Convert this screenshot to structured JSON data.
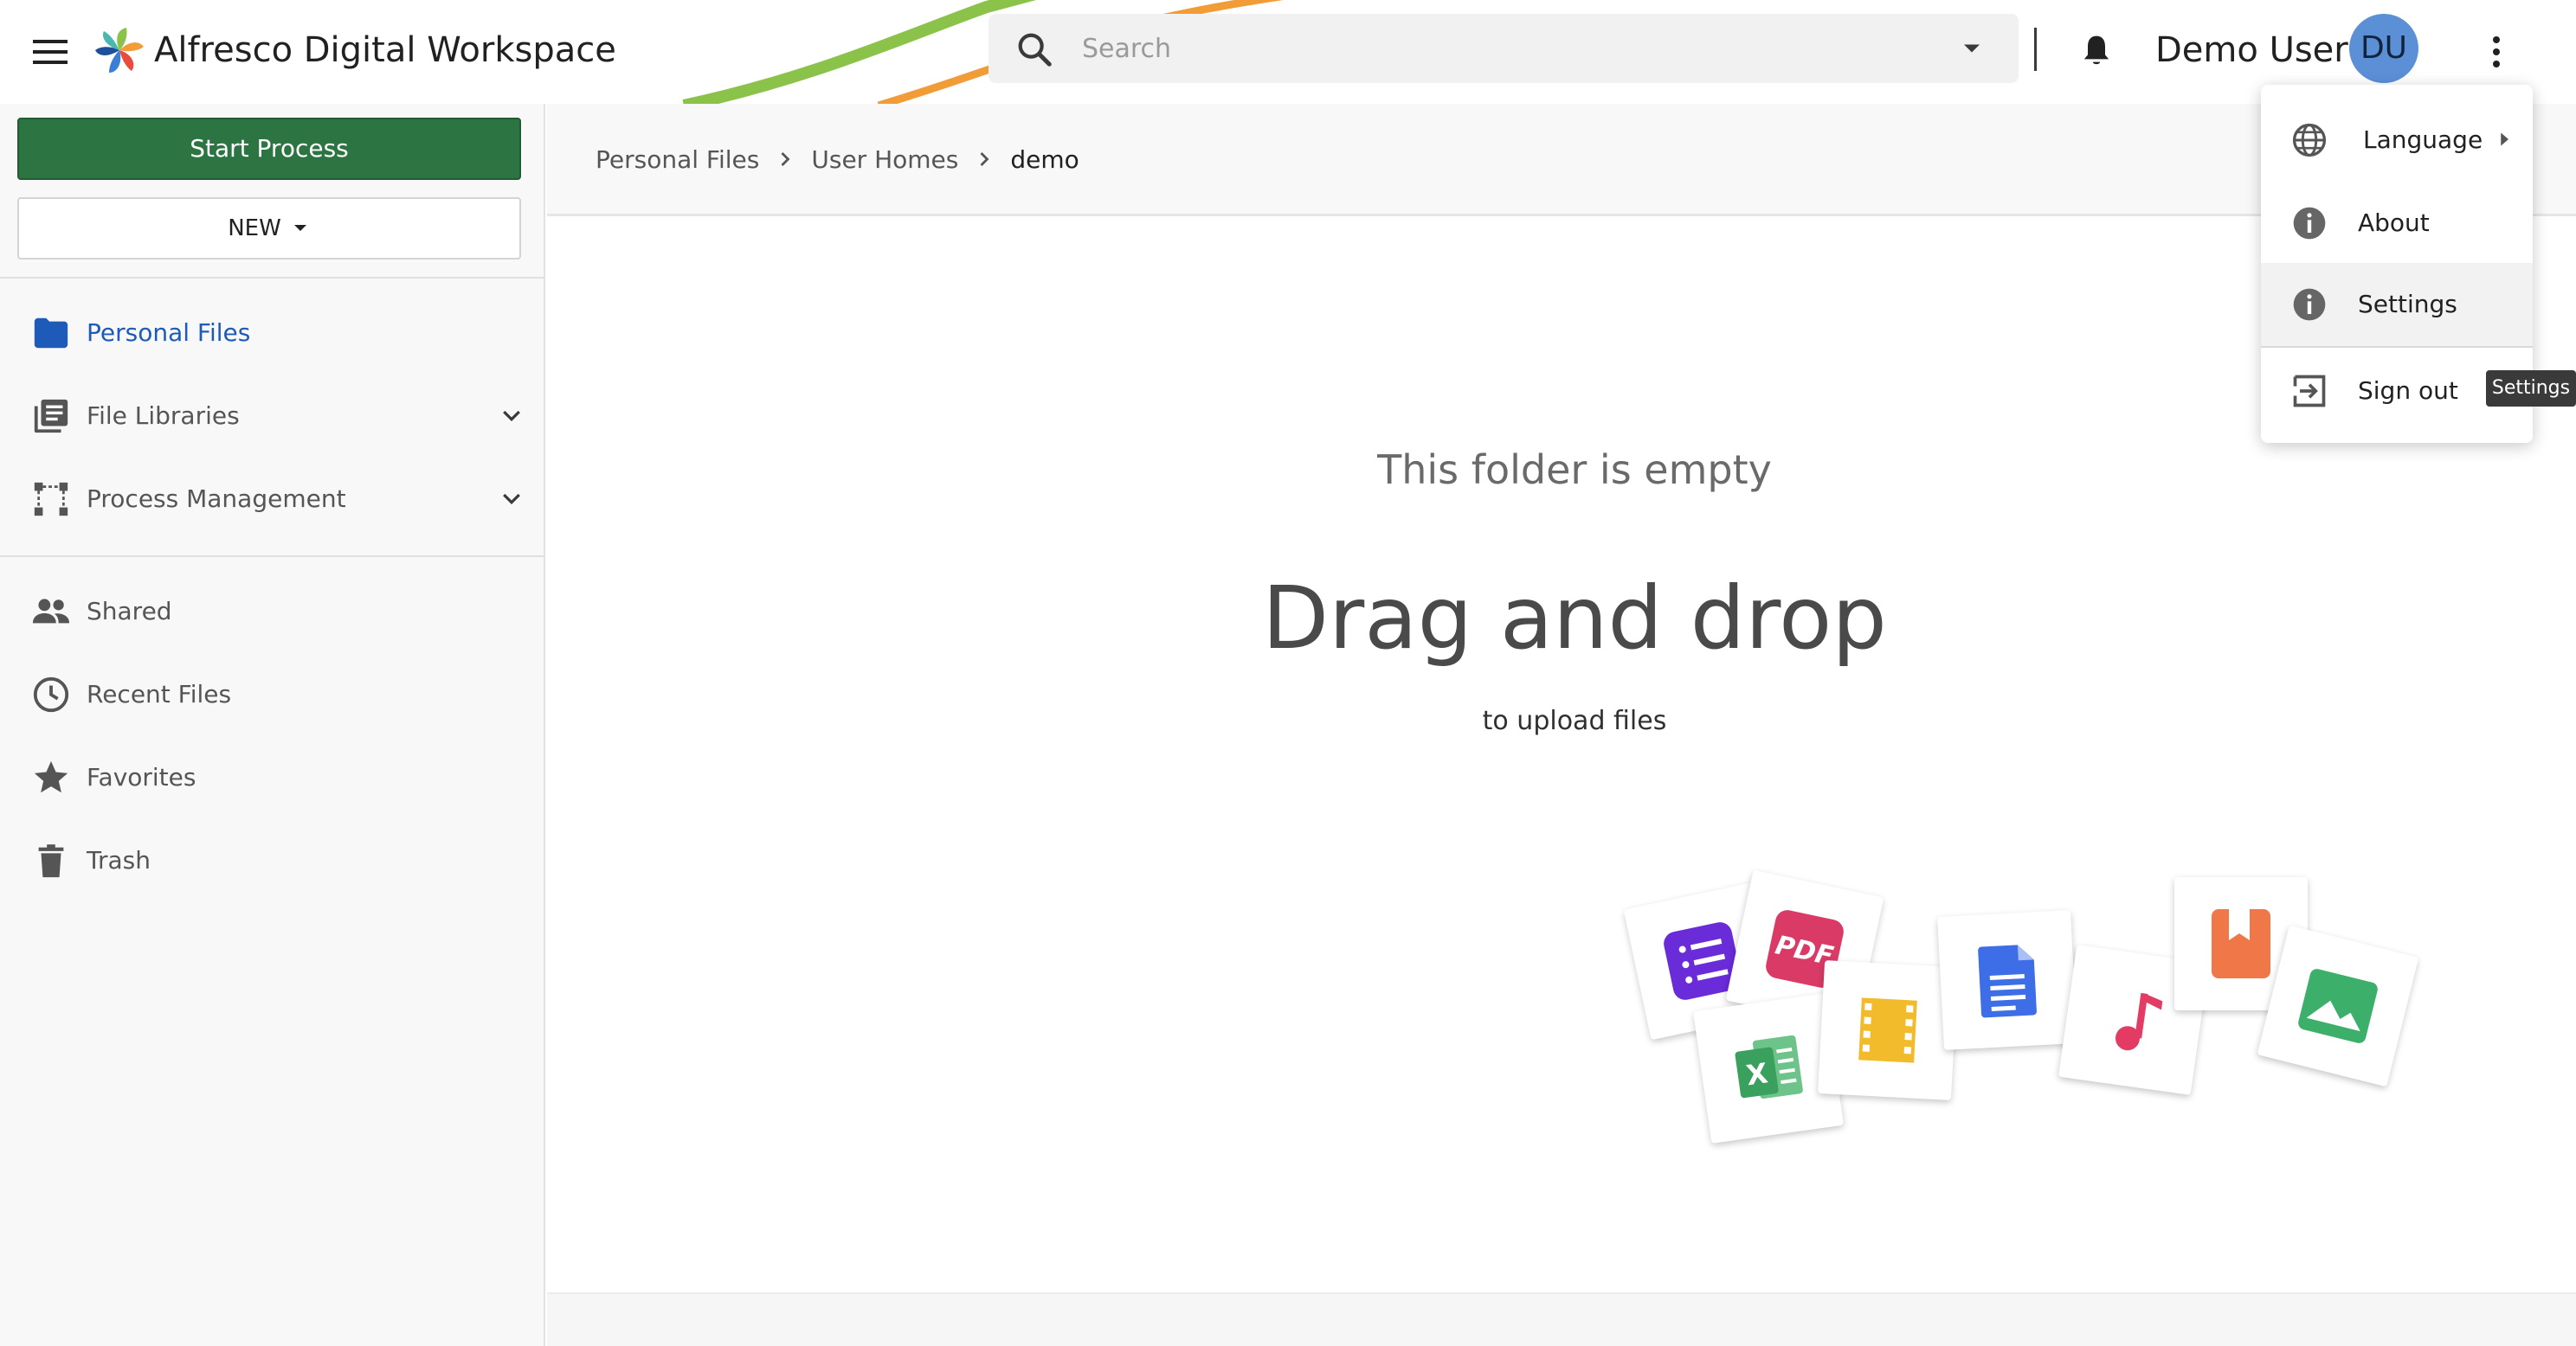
{
  "header": {
    "app_title": "Alfresco Digital Workspace",
    "search_placeholder": "Search",
    "user_name": "Demo User",
    "user_initials": "DU",
    "icons": [
      "menu-icon",
      "alfresco-logo",
      "search-icon",
      "dropdown-arrow-icon",
      "bell-icon",
      "more-vert-icon"
    ]
  },
  "sidebar": {
    "start_process": "Start Process",
    "new_button": "NEW",
    "nav": [
      {
        "label": "Personal Files",
        "icon": "folder-icon",
        "active": true
      },
      {
        "label": "File Libraries",
        "icon": "library-icon",
        "expandable": true
      },
      {
        "label": "Process Management",
        "icon": "process-icon",
        "expandable": true
      },
      {
        "label": "Shared",
        "icon": "people-icon"
      },
      {
        "label": "Recent Files",
        "icon": "clock-icon"
      },
      {
        "label": "Favorites",
        "icon": "star-icon"
      },
      {
        "label": "Trash",
        "icon": "trash-icon"
      }
    ]
  },
  "breadcrumb": [
    "Personal Files",
    "User Homes",
    "demo"
  ],
  "empty_state": {
    "title": "This folder is empty",
    "headline": "Drag and drop",
    "subtitle": "to upload files",
    "file_icons": [
      "form-icon",
      "pdf-icon",
      "spreadsheet-icon",
      "video-icon",
      "document-icon",
      "music-icon",
      "bookmark-icon",
      "image-icon"
    ]
  },
  "user_menu": {
    "items": [
      {
        "label": "Language",
        "icon": "globe-icon",
        "submenu": true
      },
      {
        "label": "About",
        "icon": "info-icon"
      },
      {
        "label": "Settings",
        "icon": "info-icon",
        "hovered": true
      },
      {
        "label": "Sign out",
        "icon": "sign-out-icon"
      }
    ],
    "tooltip": "Settings"
  },
  "colors": {
    "primary_green": "#2c7543",
    "active_blue": "#1e5bb8",
    "avatar_blue": "#5b8fd6",
    "swoosh_green": "#8bc34a",
    "swoosh_orange": "#f29c38"
  }
}
